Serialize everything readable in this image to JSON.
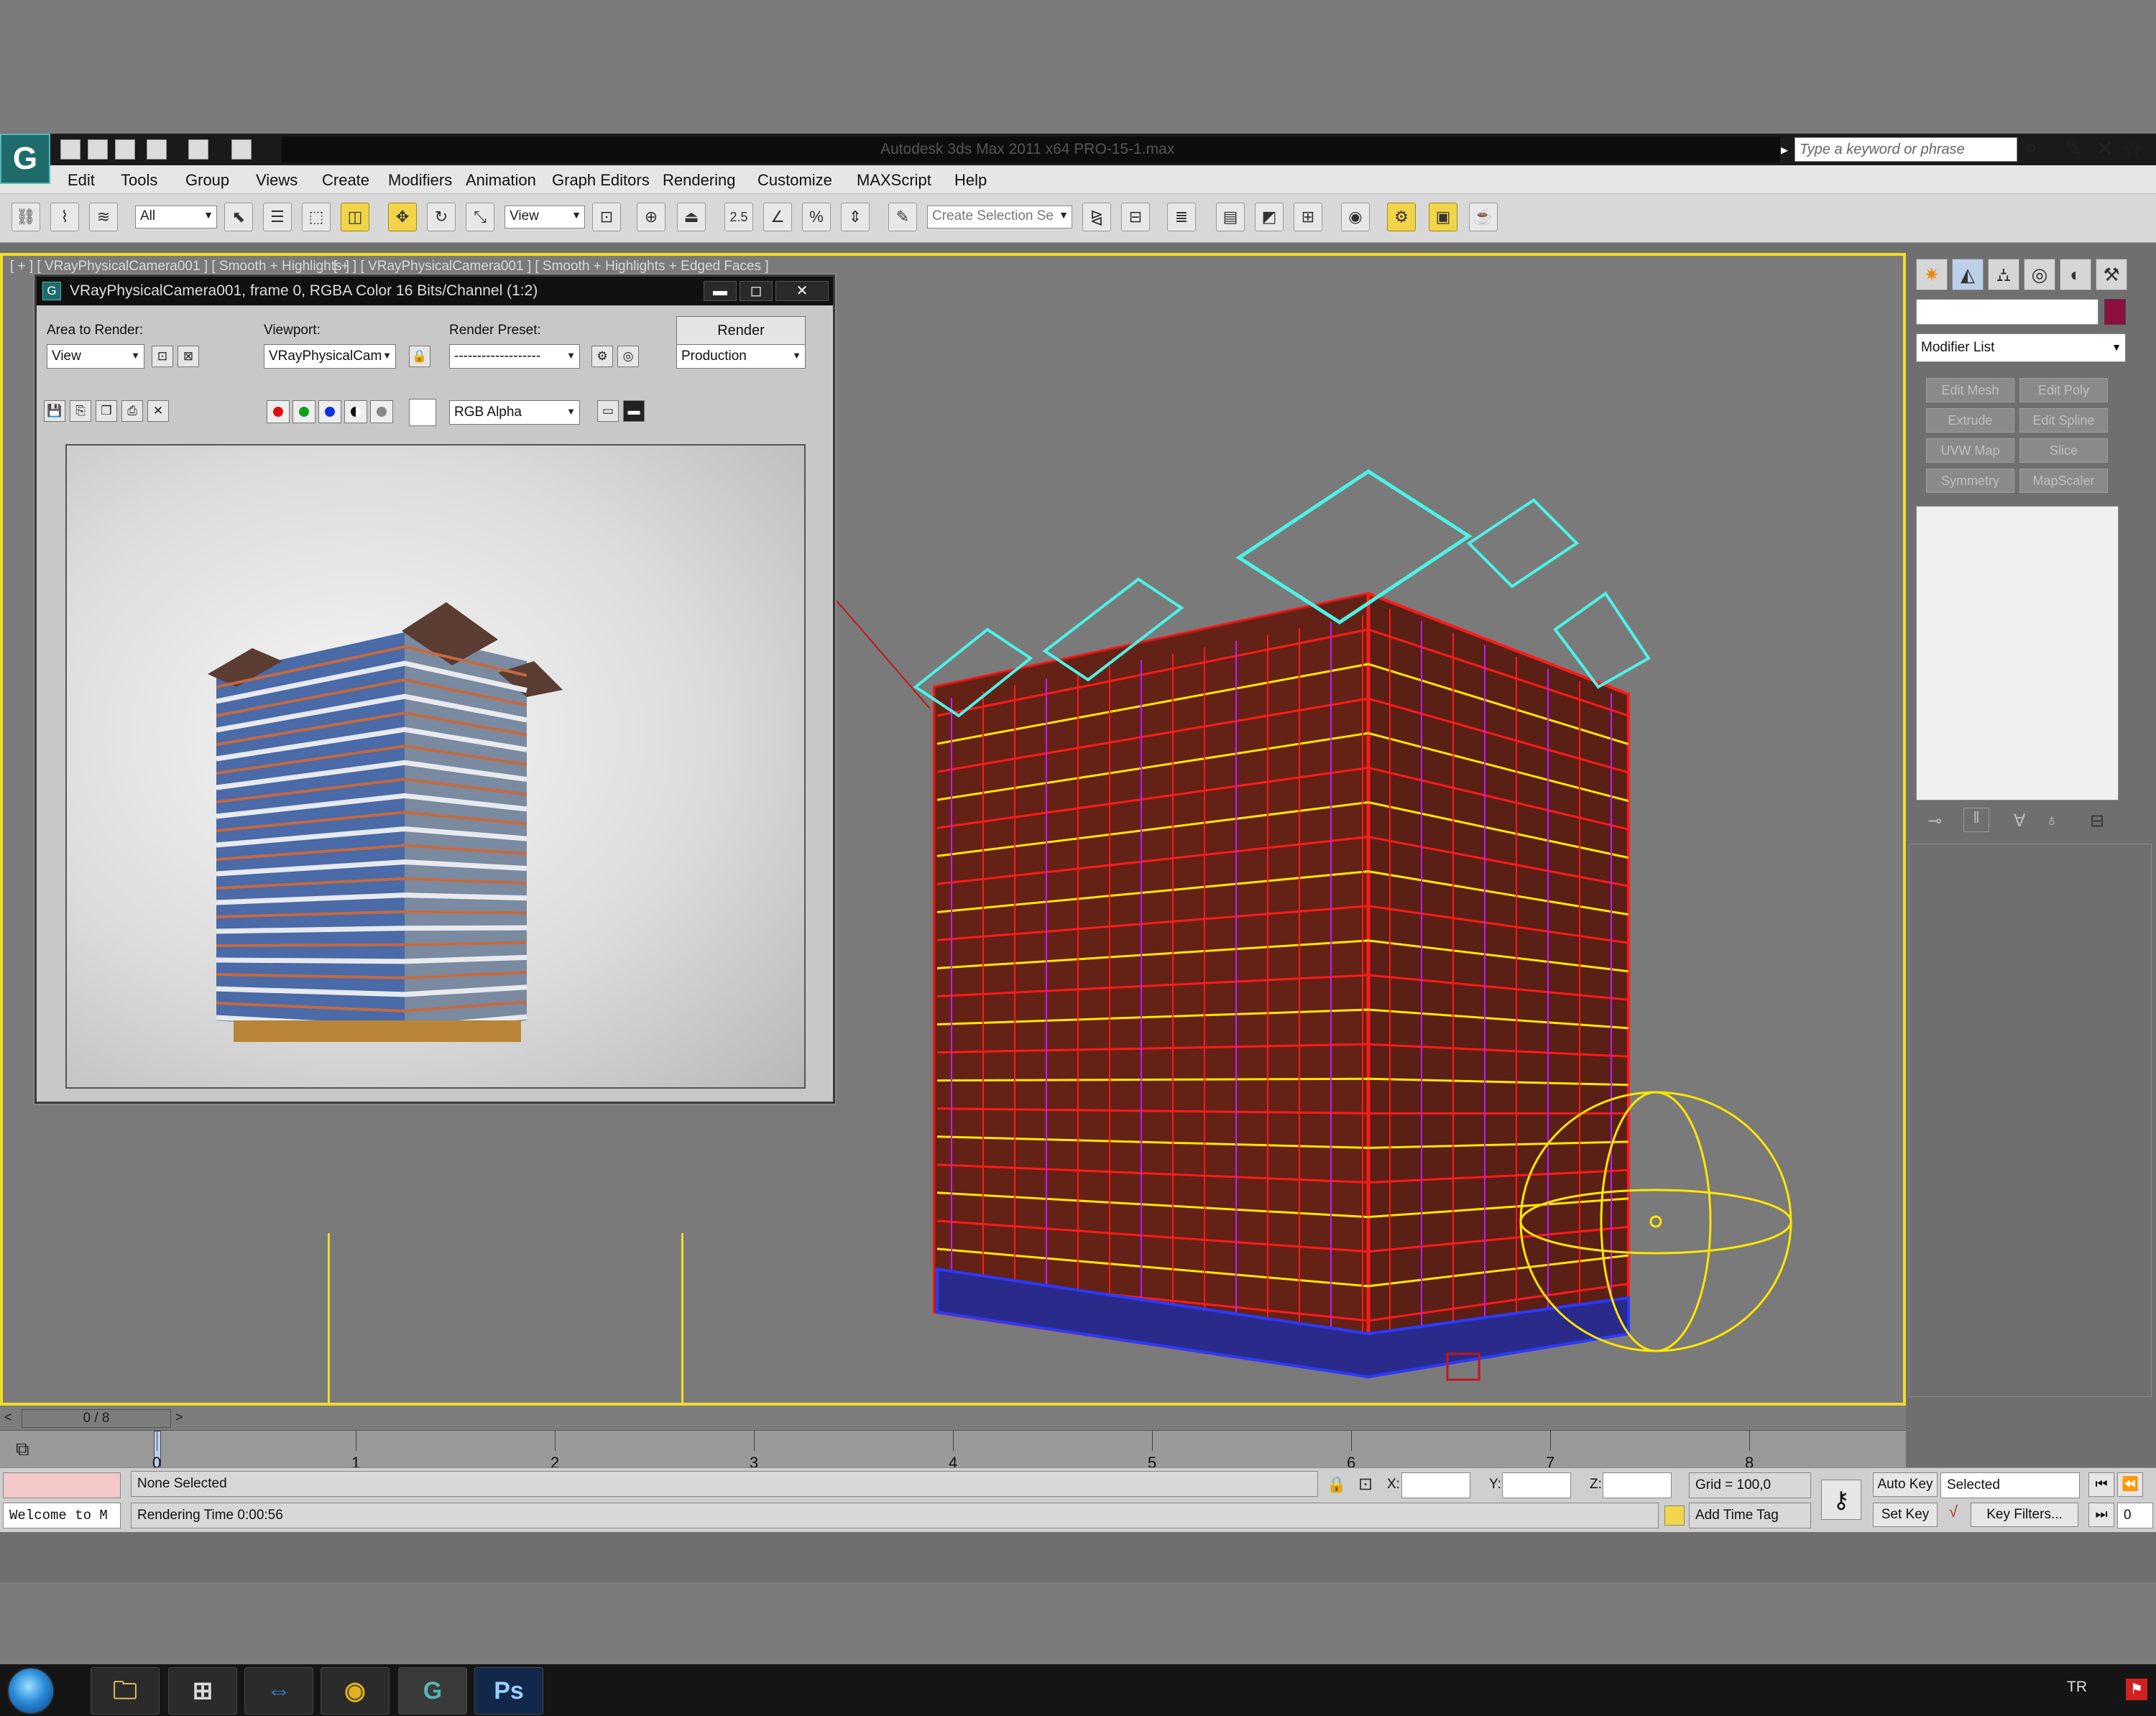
{
  "titlebar": {
    "title": "Autodesk 3ds Max  2011 x64     PRO-15-1.max",
    "search_placeholder": "Type a keyword or phrase",
    "logo": "G"
  },
  "menu": [
    "Edit",
    "Tools",
    "Group",
    "Views",
    "Create",
    "Modifiers",
    "Animation",
    "Graph Editors",
    "Rendering",
    "Customize",
    "MAXScript",
    "Help"
  ],
  "toolbar": {
    "filter_value": "All",
    "ref_coord_value": "View",
    "snap_value": "2.5",
    "selection_set_placeholder": "Create Selection Se"
  },
  "viewport": {
    "label_left": "[ + ] [ VRayPhysicalCamera001 ] [ Smooth + Highlights ]",
    "label_right": "[ + ] [ VRayPhysicalCamera001 ] [ Smooth + Highlights + Edged Faces ]"
  },
  "render_window": {
    "title": "VRayPhysicalCamera001, frame 0, RGBA Color 16 Bits/Channel (1:2)",
    "area_label": "Area to Render:",
    "area_value": "View",
    "viewport_label": "Viewport:",
    "viewport_value": "VRayPhysicalCam",
    "preset_label": "Render Preset:",
    "preset_value": "-------------------",
    "render_button": "Render",
    "production_value": "Production",
    "channel_value": "RGB Alpha",
    "minimize": "▬",
    "maximize": "◻",
    "close": "✕"
  },
  "command_panel": {
    "modifier_list": "Modifier List",
    "buttons": [
      "Edit Mesh",
      "Edit Poly",
      "Extrude",
      "Edit Spline",
      "UVW Map",
      "Slice",
      "Symmetry",
      "MapScaler"
    ],
    "object_color": "#8b1040"
  },
  "timeline": {
    "frame_counter": "0 / 8",
    "ticks": [
      "0",
      "1",
      "2",
      "3",
      "4",
      "5",
      "6",
      "7",
      "8"
    ]
  },
  "status": {
    "selection": "None Selected",
    "rendering_time": "Rendering Time  0:00:56",
    "listener": "Welcome to M",
    "x_label": "X:",
    "y_label": "Y:",
    "z_label": "Z:",
    "grid": "Grid = 100,0",
    "add_time_tag": "Add Time Tag",
    "auto_key": "Auto Key",
    "set_key": "Set Key",
    "key_selected": "Selected",
    "key_filters": "Key Filters...",
    "frame_value": "0"
  },
  "taskbar": {
    "apps": [
      "explorer-icon",
      "library-icon",
      "teamviewer-icon",
      "chrome-icon",
      "3dsmax-icon",
      "photoshop-icon"
    ],
    "photoshop_label": "Ps",
    "locale": "TR"
  },
  "colors": {
    "viewport_border": "#f0dd2a",
    "wire_red": "#ff1a1a",
    "wire_yellow": "#ffe600",
    "wire_magenta": "#c21cff",
    "wire_cyan": "#4df2e6"
  }
}
